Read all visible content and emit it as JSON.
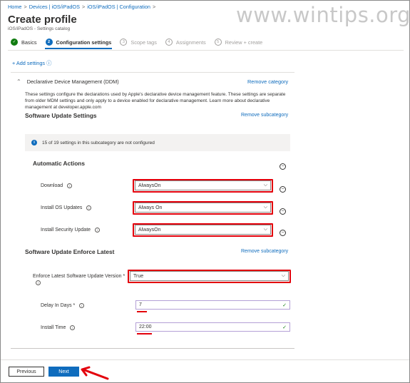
{
  "breadcrumb": [
    "Home",
    "Devices | iOS/iPadOS",
    "iOS/iPadOS | Configuration"
  ],
  "breadcrumb_sep": ">",
  "watermark": "www.wintips.org",
  "page": {
    "title": "Create profile",
    "subtitle": "iOS/iPadOS - Settings catalog"
  },
  "steps": [
    {
      "num": "✓",
      "label": "Basics",
      "state": "done"
    },
    {
      "num": "2",
      "label": "Configuration settings",
      "state": "active"
    },
    {
      "num": "3",
      "label": "Scope tags",
      "state": "pending"
    },
    {
      "num": "4",
      "label": "Assignments",
      "state": "pending"
    },
    {
      "num": "5",
      "label": "Review + create",
      "state": "pending"
    }
  ],
  "add_settings": "+ Add settings ⓘ",
  "category": {
    "chevron": "⌃",
    "name": "Declarative Device Management (DDM)",
    "remove": "Remove category",
    "description": "These settings configure the declarations used by Apple's declarative device management feature. These settings are separate from older MDM settings and only apply to a device enabled for declarative management. Learn more about declarative management at developer.apple.com"
  },
  "software_update": {
    "title": "Software Update Settings",
    "remove": "Remove subcategory",
    "info": "15 of 19 settings in this subcategory are not configured",
    "info_icon": "i",
    "auto_title": "Automatic Actions",
    "rows": [
      {
        "label": "Download",
        "value": "AlwaysOn"
      },
      {
        "label": "Install OS Updates",
        "value": "Always On"
      },
      {
        "label": "Install Security Update",
        "value": "AlwaysOn"
      }
    ]
  },
  "enforce": {
    "title": "Software Update Enforce Latest",
    "remove": "Remove subcategory",
    "version_label": "Enforce Latest Software Update Version *",
    "version_value": "True",
    "delay_label": "Delay In Days *",
    "delay_value": "7",
    "time_label": "Install Time",
    "time_value": "22:00"
  },
  "icons": {
    "info": "i",
    "collapse": "−",
    "dropdown": "⌵",
    "check": "✓"
  },
  "buttons": {
    "previous": "Previous",
    "next": "Next"
  },
  "colors": {
    "accent": "#0f6cbd",
    "highlight": "#e3000b",
    "success": "#107c10"
  }
}
